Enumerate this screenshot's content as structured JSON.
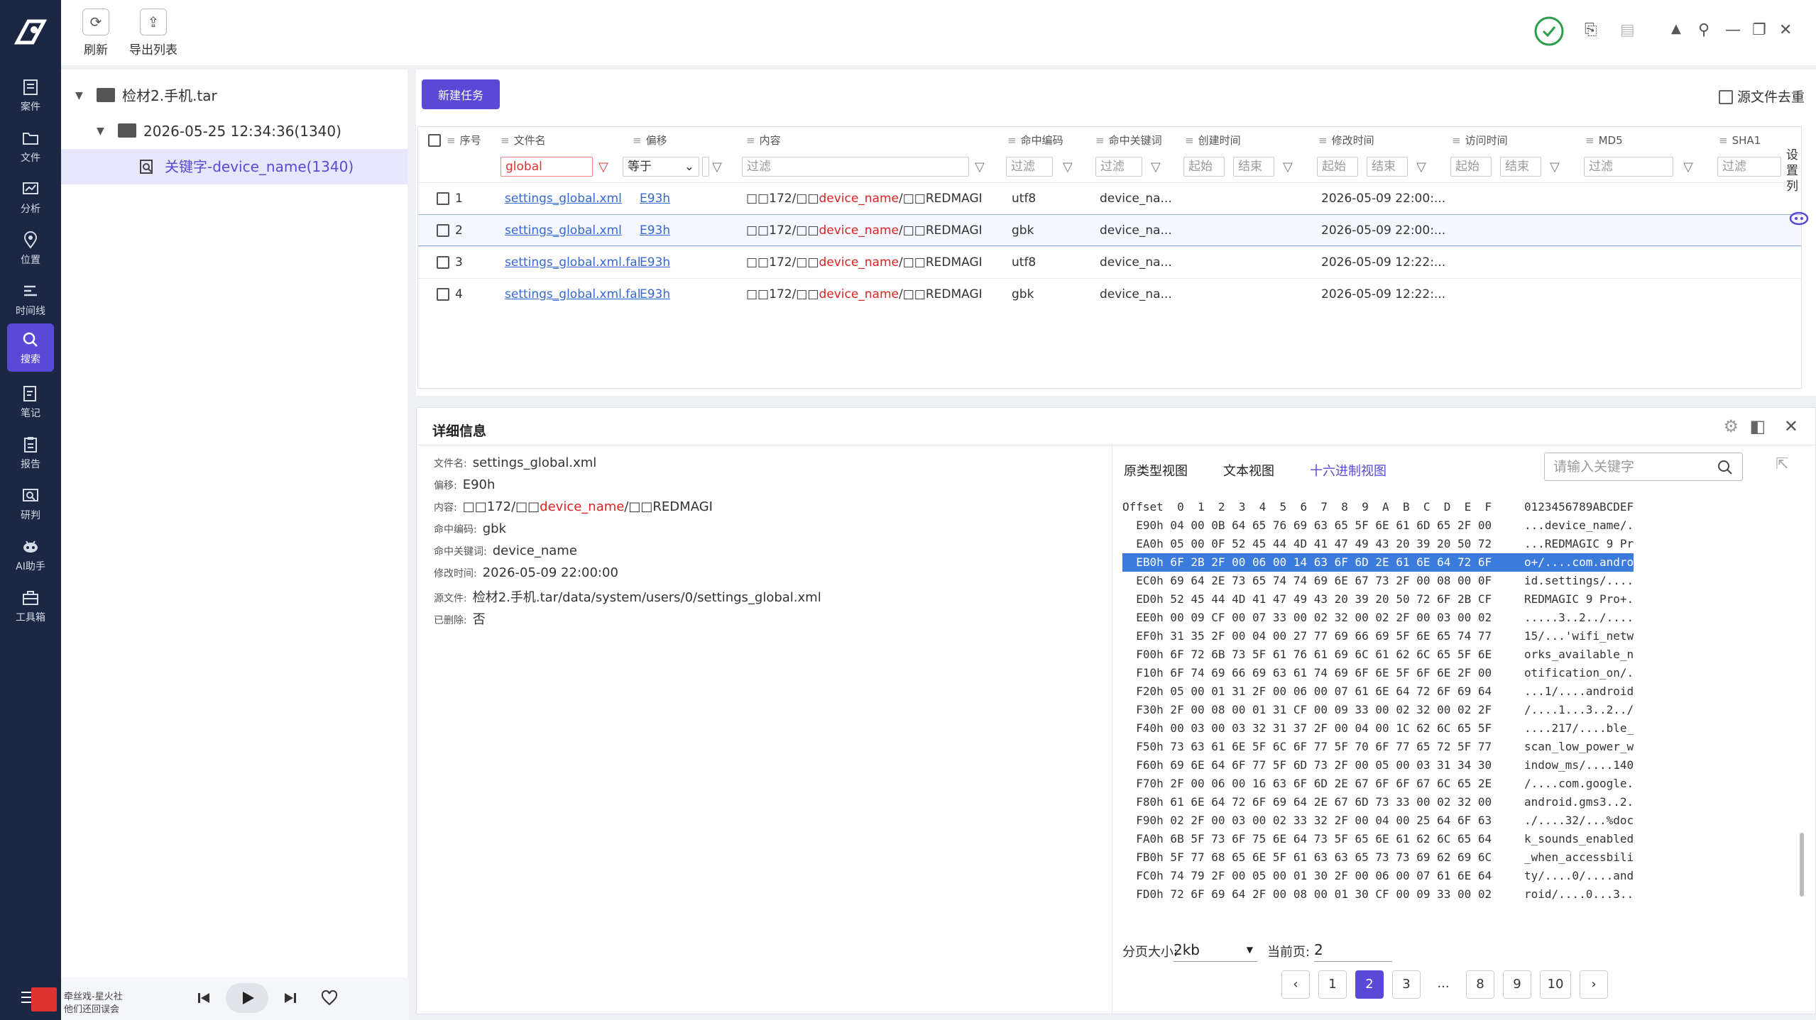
{
  "toolbar": {
    "refresh_label": "刷新",
    "export_label": "导出列表"
  },
  "sidebar": {
    "items": [
      "案件",
      "文件",
      "分析",
      "位置",
      "时间线",
      "搜索",
      "笔记",
      "报告",
      "研判",
      "AI助手",
      "工具箱"
    ]
  },
  "tree": {
    "root": "检材2.手机.tar",
    "child": "2026-05-25 12:34:36(1340)",
    "leaf": "关键字-device_name(1340)"
  },
  "tasks": {
    "new_task_label": "新建任务",
    "dedup_label": "源文件去重",
    "columns": [
      "序号",
      "文件名",
      "偏移",
      "内容",
      "命中编码",
      "命中关键词",
      "创建时间",
      "修改时间",
      "访问时间",
      "MD5",
      "SHA1"
    ],
    "filters": {
      "filename": "global",
      "offset_op": "等于",
      "placeholder": "过滤",
      "start": "起始",
      "end": "结束"
    },
    "rows": [
      {
        "no": "1",
        "file": "settings_global.xml",
        "offset": "E93h",
        "c1": "□□172/□□",
        "c2": "device_name",
        "c3": "/□□REDMAGI",
        "enc": "utf8",
        "kw": "device_na...",
        "mtime": "2026-05-09 22:00:..."
      },
      {
        "no": "2",
        "file": "settings_global.xml",
        "offset": "E93h",
        "c1": "□□172/□□",
        "c2": "device_name",
        "c3": "/□□REDMAGI",
        "enc": "gbk",
        "kw": "device_na...",
        "mtime": "2026-05-09 22:00:..."
      },
      {
        "no": "3",
        "file": "settings_global.xml.fal",
        "offset": "E93h",
        "c1": "□□172/□□",
        "c2": "device_name",
        "c3": "/□□REDMAGI",
        "enc": "utf8",
        "kw": "device_na...",
        "mtime": "2026-05-09 12:22:..."
      },
      {
        "no": "4",
        "file": "settings_global.xml.fal",
        "offset": "E93h",
        "c1": "□□172/□□",
        "c2": "device_name",
        "c3": "/□□REDMAGI",
        "enc": "gbk",
        "kw": "device_na...",
        "mtime": "2026-05-09 12:22:..."
      }
    ],
    "side_label": "设置列"
  },
  "detail": {
    "title": "详细信息",
    "fields": [
      {
        "k": "文件名:",
        "v": "settings_global.xml"
      },
      {
        "k": "偏移:",
        "v": "E90h"
      },
      {
        "k": "内容:",
        "v": "□□172/□□device_name/□□REDMAGI"
      },
      {
        "k": "命中编码:",
        "v": "gbk"
      },
      {
        "k": "命中关键词:",
        "v": "device_name"
      },
      {
        "k": "修改时间:",
        "v": "2026-05-09 22:00:00"
      },
      {
        "k": "源文件:",
        "v": "检材2.手机.tar/data/system/users/0/settings_global.xml"
      },
      {
        "k": "已删除:",
        "v": "否"
      }
    ],
    "content_parts": [
      "□□172/□□",
      "device_name",
      "/□□REDMAGI"
    ],
    "tabs": [
      "原类型视图",
      "文本视图",
      "十六进制视图"
    ],
    "keyword_placeholder": "请输入关键字",
    "hex_header": "Offset  0  1  2  3  4  5  6  7  8  9  A  B  C  D  E  F",
    "ascii_header": "0123456789ABCDEF",
    "hex_rows": [
      "  E90h 04 00 0B 64 65 76 69 63 65 5F 6E 61 6D 65 2F 00",
      "  EA0h 05 00 0F 52 45 44 4D 41 47 49 43 20 39 20 50 72",
      "  EB0h 6F 2B 2F 00 06 00 14 63 6F 6D 2E 61 6E 64 72 6F",
      "  EC0h 69 64 2E 73 65 74 74 69 6E 67 73 2F 00 08 00 0F",
      "  ED0h 52 45 44 4D 41 47 49 43 20 39 20 50 72 6F 2B CF",
      "  EE0h 00 09 CF 00 07 33 00 02 32 00 02 2F 00 03 00 02",
      "  EF0h 31 35 2F 00 04 00 27 77 69 66 69 5F 6E 65 74 77",
      "  F00h 6F 72 6B 73 5F 61 76 61 69 6C 61 62 6C 65 5F 6E",
      "  F10h 6F 74 69 66 69 63 61 74 69 6F 6E 5F 6F 6E 2F 00",
      "  F20h 05 00 01 31 2F 00 06 00 07 61 6E 64 72 6F 69 64",
      "  F30h 2F 00 08 00 01 31 CF 00 09 33 00 02 32 00 02 2F",
      "  F40h 00 03 00 03 32 31 37 2F 00 04 00 1C 62 6C 65 5F",
      "  F50h 73 63 61 6E 5F 6C 6F 77 5F 70 6F 77 65 72 5F 77",
      "  F60h 69 6E 64 6F 77 5F 6D 73 2F 00 05 00 03 31 34 30",
      "  F70h 2F 00 06 00 16 63 6F 6D 2E 67 6F 6F 67 6C 65 2E",
      "  F80h 61 6E 64 72 6F 69 64 2E 67 6D 73 33 00 02 32 00",
      "  F90h 02 2F 00 03 00 02 33 32 2F 00 04 00 25 64 6F 63",
      "  FA0h 6B 5F 73 6F 75 6E 64 73 5F 65 6E 61 62 6C 65 64",
      "  FB0h 5F 77 68 65 6E 5F 61 63 63 65 73 73 69 62 69 6C",
      "  FC0h 74 79 2F 00 05 00 01 30 2F 00 06 00 07 61 6E 64",
      "  FD0h 72 6F 69 64 2F 00 08 00 01 30 CF 00 09 33 00 02"
    ],
    "ascii_rows": [
      "...device_name/.",
      "...REDMAGIC 9 Pr",
      "o+/....com.andro",
      "id.settings/....",
      "REDMAGIC 9 Pro+.",
      ".....3..2../....",
      "15/...'wifi_netw",
      "orks_available_n",
      "otification_on/.",
      "...1/....android",
      "/....1...3..2../",
      "....217/....ble_",
      "scan_low_power_w",
      "indow_ms/....140",
      "/....com.google.",
      "android.gms3..2.",
      "./....32/...%doc",
      "k_sounds_enabled",
      "_when_accessbili",
      "ty/....0/....and",
      "roid/....0...3.."
    ],
    "page_size_label": "分页大小:",
    "page_size": "2kb",
    "current_page_label": "当前页:",
    "current_page": "2",
    "pages": [
      "1",
      "2",
      "3",
      "...",
      "8",
      "9",
      "10"
    ]
  },
  "music": {
    "line1": "牵丝戏-星火社",
    "line2": "他们还回误会"
  }
}
